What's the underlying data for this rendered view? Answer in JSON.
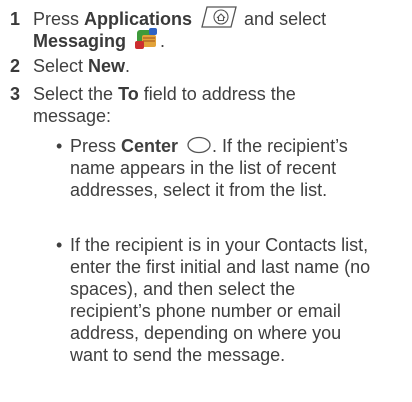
{
  "steps": [
    {
      "number": "1",
      "line1_pre": "Press ",
      "line1_bold": "Applications",
      "line1_post": " and select",
      "line2_bold": "Messaging",
      "line2_post": "."
    },
    {
      "number": "2",
      "pre": "Select ",
      "bold": "New",
      "post": "."
    },
    {
      "number": "3",
      "line1_pre": "Select the ",
      "line1_bold": "To",
      "line1_post": " field to address the",
      "line2": "message:",
      "bullets": [
        {
          "line1_pre": "Press ",
          "line1_bold": "Center",
          "line1_post": ". If the recipient’s",
          "lines": [
            "name appears in the list of recent",
            "addresses, select it from the list."
          ]
        },
        {
          "lines": [
            "If the recipient is in your Contacts list,",
            "enter the first initial and last name (no",
            "spaces), and then select the",
            "recipient’s phone number or email",
            "address, depending on where you",
            "want to send the message."
          ]
        }
      ]
    }
  ],
  "bullet_char": "•",
  "icons": [
    "applications-icon",
    "messaging-icon",
    "center-button-icon"
  ],
  "colors": {
    "text": "#3f3f3f",
    "background": "#ffffff"
  }
}
